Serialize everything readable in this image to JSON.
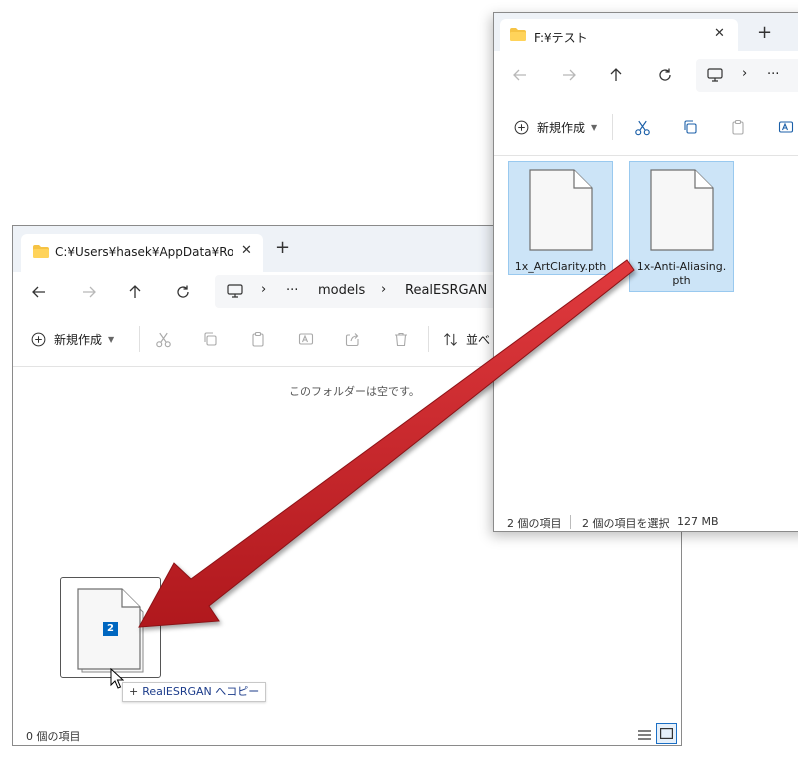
{
  "left_window": {
    "tab_title": "C:¥Users¥hasek¥AppData¥Roa",
    "breadcrumbs": [
      "models",
      "RealESRGAN"
    ],
    "overflow": "···",
    "new_label": "新規作成",
    "sort_label": "並べ",
    "empty_message": "このフォルダーは空です。",
    "status": "0 個の項目"
  },
  "right_window": {
    "tab_title": "F:¥テスト",
    "overflow": "···",
    "new_label": "新規作成",
    "files": [
      {
        "name": "1x_ArtClarity.pth"
      },
      {
        "name": "1x-Anti-Aliasing.\npth"
      }
    ],
    "status_count": "2 個の項目",
    "status_selected": "2 個の項目を選択",
    "status_size": "127 MB"
  },
  "drag": {
    "count_badge": "2",
    "copy_tooltip": "RealESRGAN へコピー",
    "copy_symbol": "+"
  },
  "colors": {
    "arrow": "#c8262b",
    "selection": "#cce4f7",
    "folder": "#f6c344",
    "badge": "#0067c0"
  }
}
